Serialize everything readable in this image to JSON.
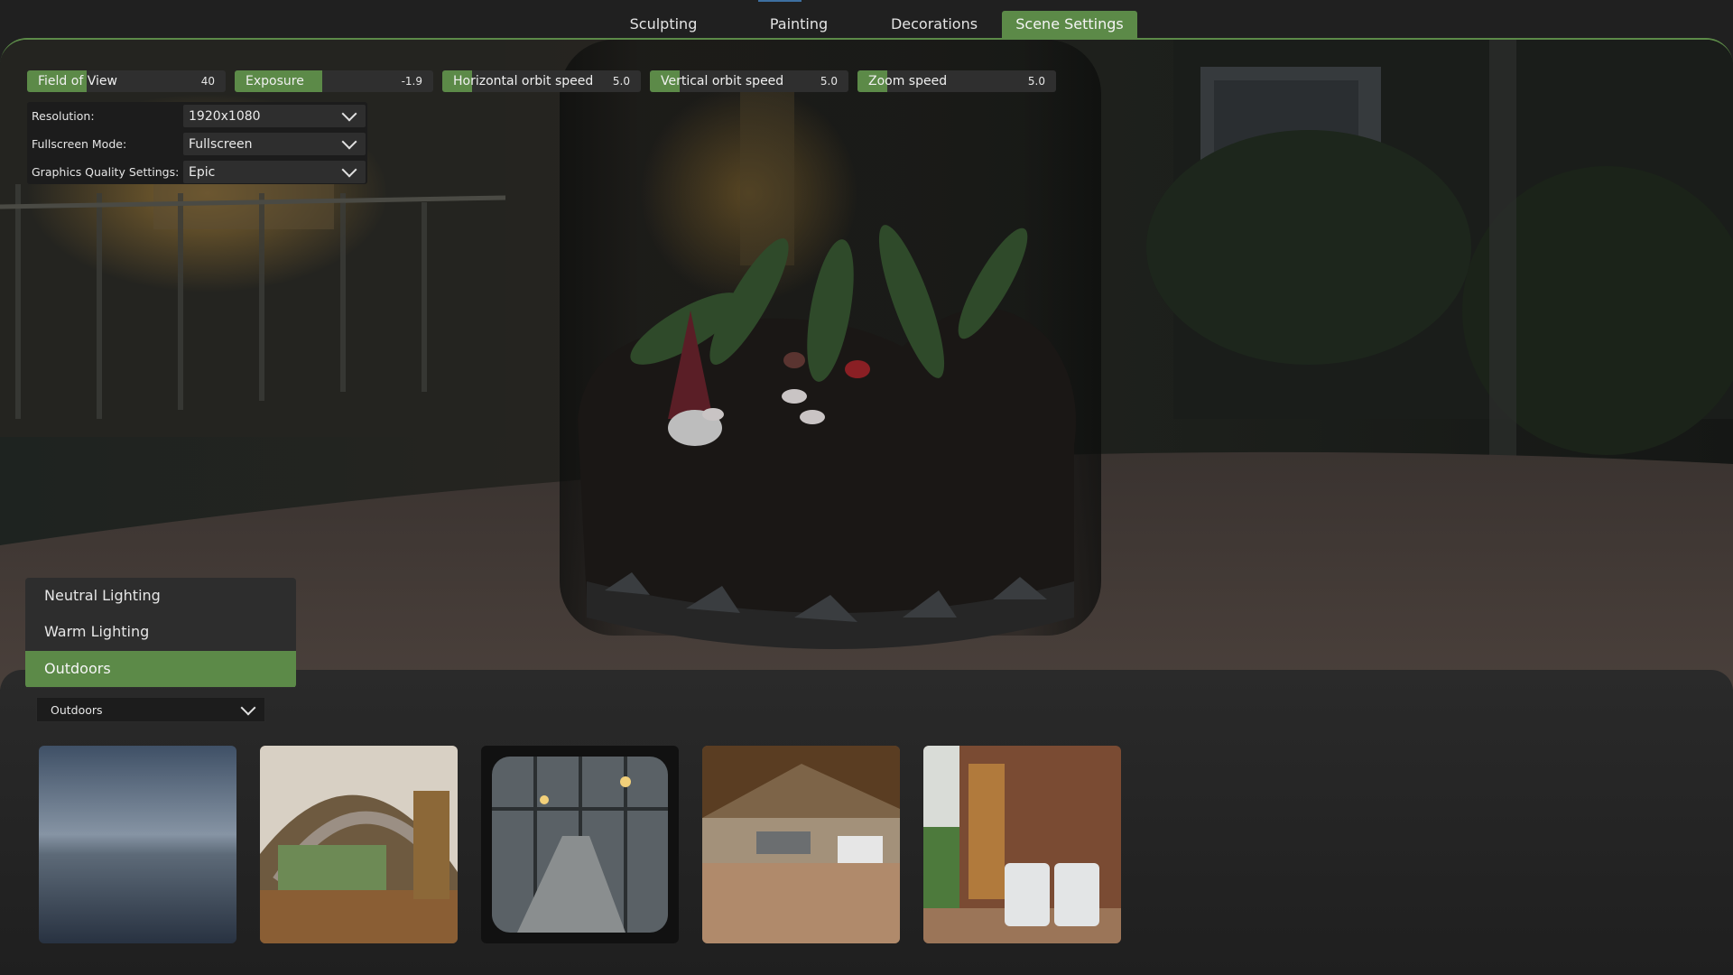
{
  "tabs": [
    {
      "label": "Sculpting"
    },
    {
      "label": "Painting"
    },
    {
      "label": "Decorations"
    },
    {
      "label": "Scene Settings",
      "active": true
    }
  ],
  "sliders": [
    {
      "label": "Field of View",
      "value": "40",
      "fill": 0.3
    },
    {
      "label": "Exposure",
      "value": "-1.9",
      "fill": 0.44
    },
    {
      "label": "Horizontal orbit speed",
      "value": "5.0",
      "fill": 0.15
    },
    {
      "label": "Vertical orbit speed",
      "value": "5.0",
      "fill": 0.15
    },
    {
      "label": "Zoom speed",
      "value": "5.0",
      "fill": 0.15
    }
  ],
  "settings": [
    {
      "label": "Resolution:",
      "value": "1920x1080"
    },
    {
      "label": "Fullscreen Mode:",
      "value": "Fullscreen"
    },
    {
      "label": "Graphics Quality Settings:",
      "value": "Epic"
    }
  ],
  "lighting_presets": [
    {
      "label": "Neutral Lighting"
    },
    {
      "label": "Warm Lighting"
    },
    {
      "label": "Outdoors",
      "active": true
    }
  ],
  "environment_select": {
    "value": "Outdoors"
  },
  "environment_thumbnails": [
    {
      "icon": "sky-gradient-thumbnail"
    },
    {
      "icon": "arched-porch-thumbnail"
    },
    {
      "icon": "greenhouse-corridor-thumbnail"
    },
    {
      "icon": "pavilion-thumbnail"
    },
    {
      "icon": "brick-patio-chairs-thumbnail"
    }
  ],
  "colors": {
    "accent": "#5c8a48",
    "panel": "#2d2d2d",
    "background": "#202020",
    "tab_indicator": "#3d6fa0"
  }
}
